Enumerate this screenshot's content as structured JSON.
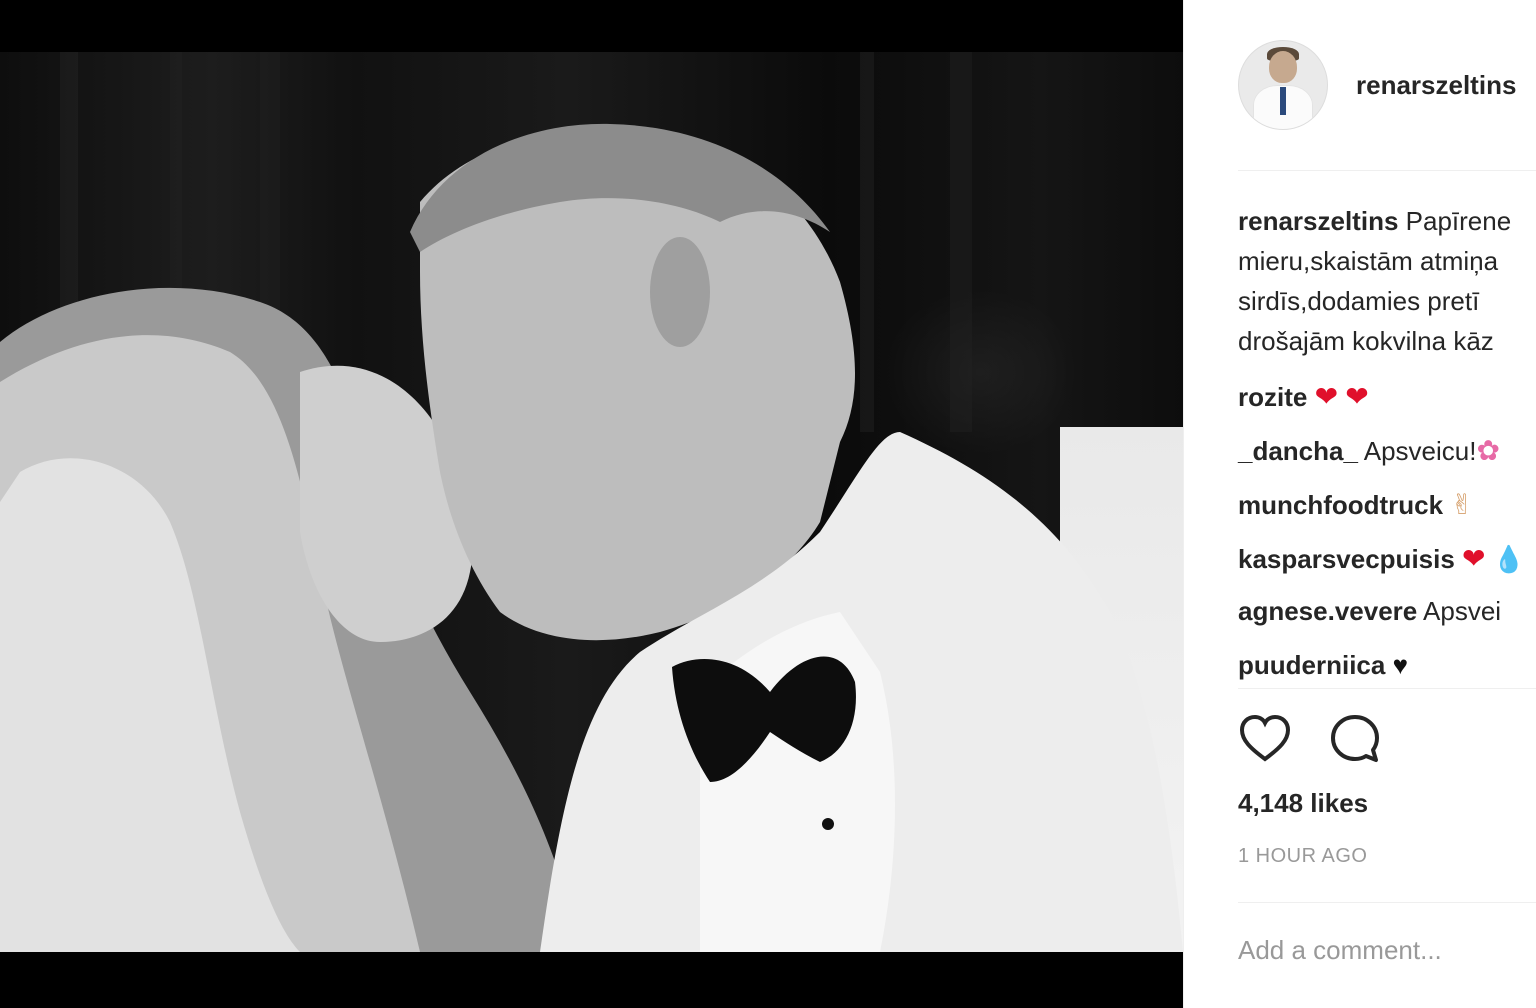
{
  "post": {
    "username": "renarszeltins",
    "caption_lines": [
      "Papīrene",
      "mieru,skaistām atmiņa",
      "sirdīs,dodamies pretī",
      "drošajām kokvilna kāz"
    ],
    "comments": [
      {
        "user": "rozite",
        "text": "",
        "emoji": [
          "heart-red",
          "heart-red"
        ]
      },
      {
        "user": "_dancha_",
        "text": "Apsveicu!",
        "emoji": [
          "flower"
        ]
      },
      {
        "user": "munchfoodtruck",
        "text": "",
        "emoji": [
          "rock-hand"
        ]
      },
      {
        "user": "kasparsvecpuisis",
        "text": "",
        "emoji": [
          "heart-red",
          "droplet"
        ]
      },
      {
        "user": "agnese.vevere",
        "text": "Apsvei",
        "emoji": []
      },
      {
        "user": "puuderniica",
        "text": "",
        "emoji": [
          "heart-black"
        ]
      }
    ],
    "likes": "4,148 likes",
    "time": "1 HOUR AGO",
    "add_comment_placeholder": "Add a comment...",
    "icons": {
      "like": "heart-outline-icon",
      "comment": "speech-bubble-icon"
    }
  }
}
